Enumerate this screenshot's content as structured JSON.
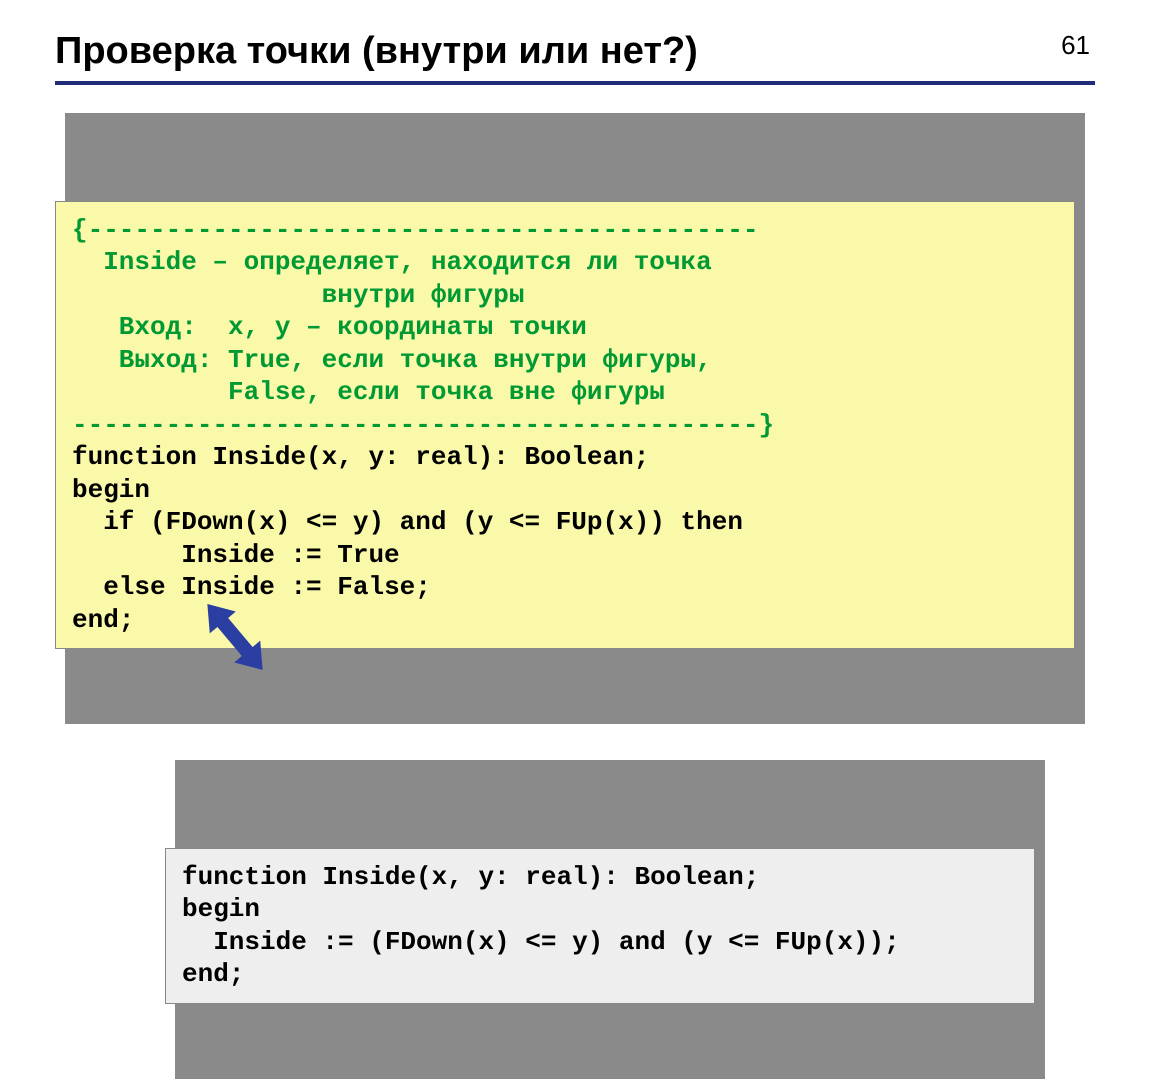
{
  "page_number": "61",
  "title": "Проверка точки (внутри или нет?)",
  "code1": {
    "c1": "{-------------------------------------------",
    "c2": "  Inside – определяет, находится ли точка",
    "c3": "                внутри фигуры",
    "c4": "   Вход:  x, y – координаты точки",
    "c5": "   Выход: True, если точка внутри фигуры,",
    "c6": "          False, если точка вне фигуры",
    "c7": "--------------------------------------------}",
    "l1a": "function",
    "l1b": " Inside(x, y: real): Boolean;",
    "l2": "begin",
    "l3a": "  if",
    "l3b": " (FDown(x) <= y) ",
    "l3c": "and",
    "l3d": " (y <= FUp(x)) ",
    "l3e": "then",
    "l4a": "       Inside := ",
    "l4b": "True",
    "l5a": "  else",
    "l5b": " Inside := ",
    "l5c": "False",
    "l5d": ";",
    "l6": "end;"
  },
  "code2": {
    "l1a": "function",
    "l1b": " Inside(x, y: real): Boolean;",
    "l2": "begin",
    "l3a": "  Inside := (FDown(x) <= y) ",
    "l3b": "and",
    "l3c": " (y <= FUp(x));",
    "l4": "end;"
  }
}
